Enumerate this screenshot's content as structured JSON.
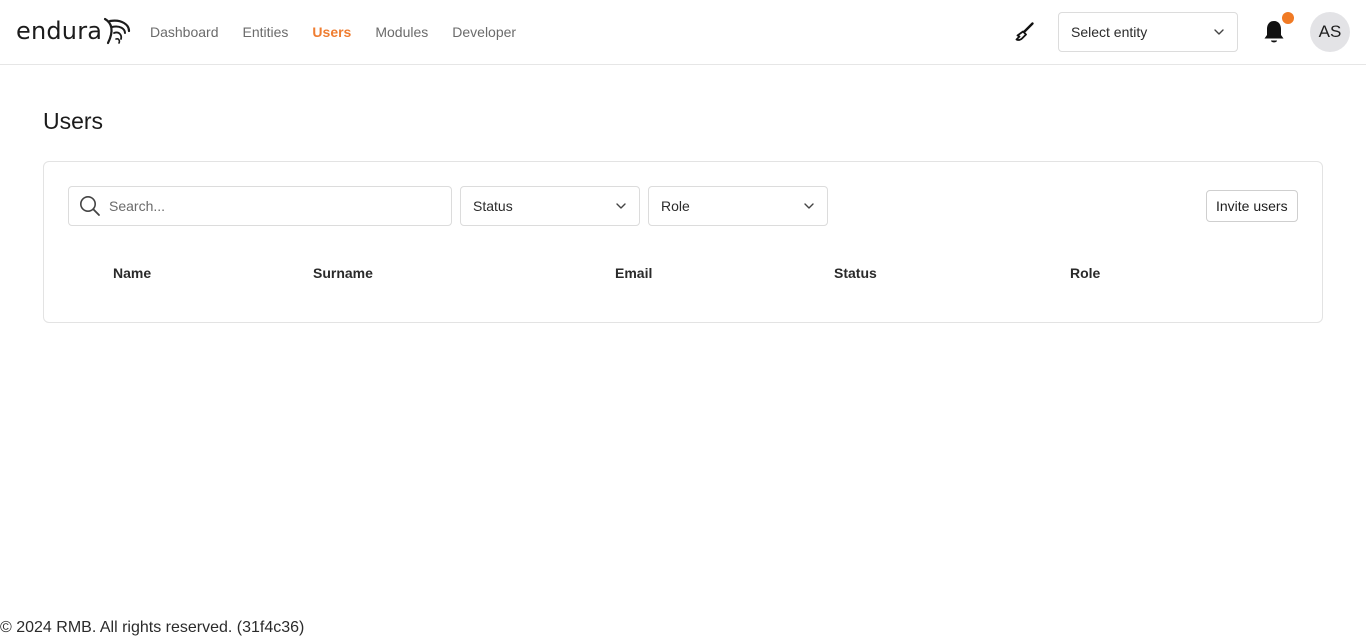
{
  "brand": {
    "name": "endura"
  },
  "nav": {
    "items": [
      {
        "label": "Dashboard",
        "active": false
      },
      {
        "label": "Entities",
        "active": false
      },
      {
        "label": "Users",
        "active": true
      },
      {
        "label": "Modules",
        "active": false
      },
      {
        "label": "Developer",
        "active": false
      }
    ]
  },
  "header": {
    "entity_select": {
      "value": "Select entity"
    },
    "avatar_initials": "AS",
    "notification_dot_color": "#f07a24"
  },
  "page": {
    "title": "Users"
  },
  "filters": {
    "search_placeholder": "Search...",
    "status_label": "Status",
    "role_label": "Role",
    "invite_label": "Invite users"
  },
  "table": {
    "columns": [
      "Name",
      "Surname",
      "Email",
      "Status",
      "Role"
    ],
    "rows": []
  },
  "footer": {
    "text": "© 2024 RMB. All rights reserved. (31f4c36)"
  },
  "colors": {
    "accent": "#ef7d31"
  }
}
